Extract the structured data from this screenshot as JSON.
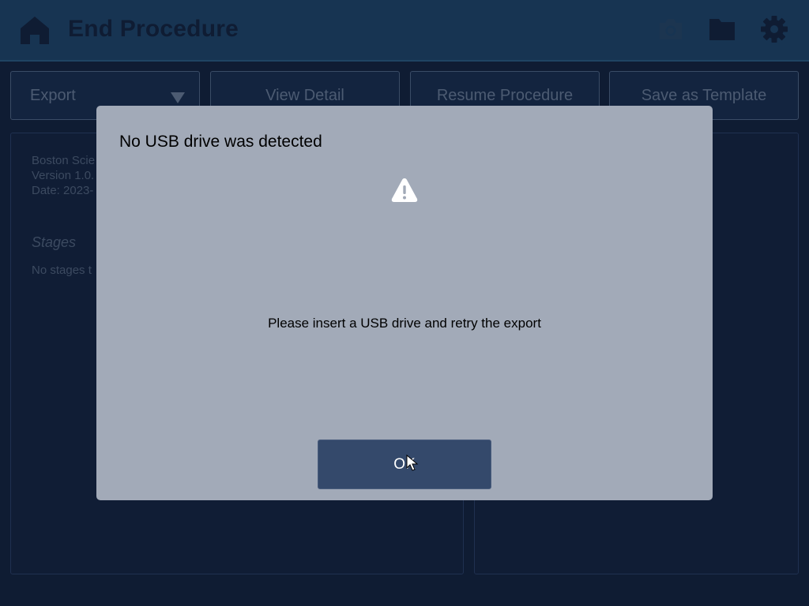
{
  "header": {
    "title": "End Procedure",
    "icons": [
      "home-icon",
      "camera-icon",
      "folder-icon",
      "gear-icon"
    ]
  },
  "toolbar": {
    "export_label": "Export",
    "view_detail_label": "View Detail",
    "resume_label": "Resume Procedure",
    "save_template_label": "Save as Template"
  },
  "left_panel": {
    "line1": "Boston Scie",
    "line2": "Version 1.0.",
    "line3": "Date: 2023-",
    "stages_heading": "Stages",
    "stages_text": "No stages t"
  },
  "dialog": {
    "title": "No USB drive was detected",
    "icon": "warning-icon",
    "message": "Please insert a USB drive and retry the export",
    "ok_label": "OK"
  },
  "colors": {
    "background": "#0f1c33",
    "header": "#173452",
    "dialog": "#a2aab8",
    "ok_button": "#34496b"
  }
}
